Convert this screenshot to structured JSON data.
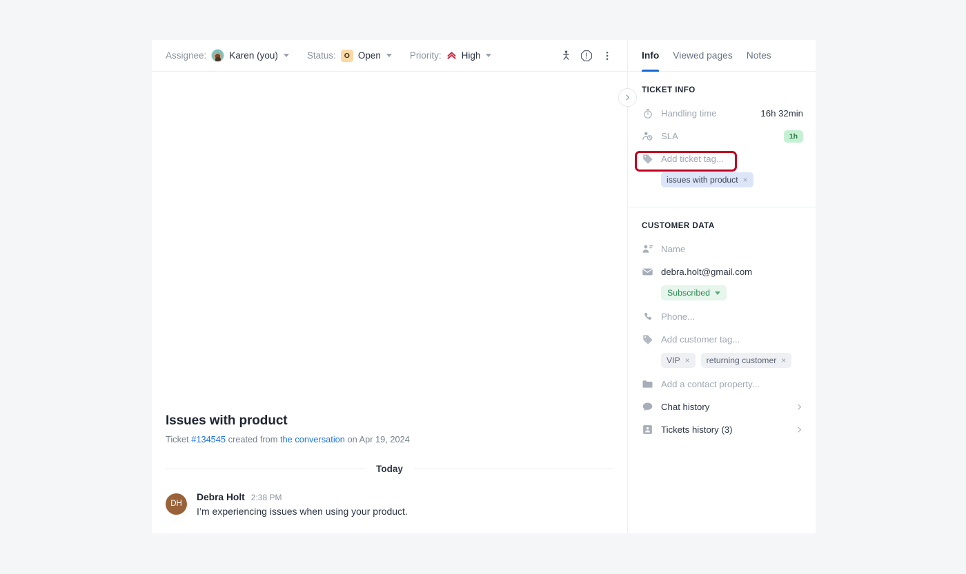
{
  "toolbar": {
    "assignee_label": "Assignee:",
    "assignee_value": "Karen (you)",
    "status_label": "Status:",
    "status_badge": "O",
    "status_value": "Open",
    "priority_label": "Priority:",
    "priority_value": "High",
    "icons": {
      "person": "person-icon",
      "alert": "alert-octagon-icon",
      "more": "more-vertical-icon"
    }
  },
  "conversation": {
    "title": "Issues with product",
    "sub_prefix": "Ticket ",
    "sub_ticket_id": "#134545",
    "sub_mid": " created from ",
    "sub_link": "the conversation",
    "sub_suffix": " on Apr 19, 2024",
    "day_label": "Today",
    "message": {
      "avatar_initials": "DH",
      "author": "Debra Holt",
      "time": "2:38 PM",
      "text": "I’m experiencing issues when using your product."
    }
  },
  "details": {
    "tabs": [
      {
        "label": "Info",
        "active": true
      },
      {
        "label": "Viewed pages",
        "active": false
      },
      {
        "label": "Notes",
        "active": false
      }
    ],
    "collapse_icon": "chevron-right-icon",
    "ticket_info": {
      "title": "TICKET INFO",
      "handling_time_label": "Handling time",
      "handling_time_value": "16h 32min",
      "sla_label": "SLA",
      "sla_badge": "1h",
      "add_ticket_tag_placeholder": "Add ticket tag...",
      "tags": [
        {
          "label": "issues with product",
          "remove": "×"
        }
      ]
    },
    "customer_data": {
      "title": "CUSTOMER DATA",
      "name_placeholder": "Name",
      "email_value": "debra.holt@gmail.com",
      "subscription_status": "Subscribed",
      "phone_placeholder": "Phone...",
      "add_customer_tag_placeholder": "Add customer tag...",
      "customer_tags": [
        {
          "label": "VIP",
          "remove": "×"
        },
        {
          "label": "returning customer",
          "remove": "×"
        }
      ],
      "add_contact_property_placeholder": "Add a contact property...",
      "chat_history_label": "Chat history",
      "tickets_history_label": "Tickets history (3)"
    }
  },
  "colors": {
    "page_bg": "#f4f6f8",
    "accent_blue": "#1167d4",
    "link_blue": "#1a73e8",
    "highlight_red": "#c1001f",
    "priority_red": "#d6263f",
    "status_amber": "#fbd9a5",
    "sla_green": "#c6f0d4",
    "avatar_brown": "#9a6239"
  }
}
